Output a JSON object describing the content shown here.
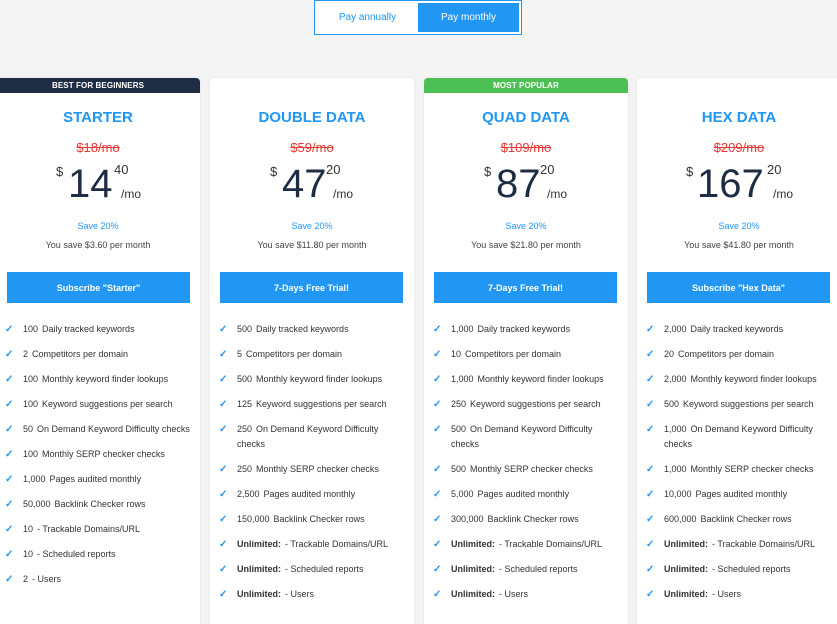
{
  "billing_toggle": {
    "annual": "Pay annually",
    "monthly": "Pay monthly"
  },
  "accent_color": "#2196f3",
  "plans": [
    {
      "ribbon": "BEST FOR BEGINNERS",
      "name": "STARTER",
      "old_price_cur": "$",
      "old_price": "18/mo",
      "currency": "$",
      "price_int": "14",
      "price_cents": "40",
      "per": "/mo",
      "save_pct": "Save 20%",
      "save_amt": "You save $3.60 per month",
      "cta": "Subscribe \"Starter\"",
      "features": [
        {
          "num": "100",
          "text": "Daily tracked keywords"
        },
        {
          "num": "2",
          "text": "Competitors per domain"
        },
        {
          "num": "100",
          "text": "Monthly keyword finder lookups"
        },
        {
          "num": "100",
          "text": "Keyword suggestions per search"
        },
        {
          "num": "50",
          "text": "On Demand Keyword Difficulty checks"
        },
        {
          "num": "100",
          "text": "Monthly SERP checker checks"
        },
        {
          "num": "1,000",
          "text": "Pages audited monthly"
        },
        {
          "num": "50,000",
          "text": "Backlink Checker rows"
        },
        {
          "num": "10",
          "text": "- Trackable Domains/URL"
        },
        {
          "num": "10",
          "text": "- Scheduled reports"
        },
        {
          "num": "2",
          "text": "- Users"
        }
      ]
    },
    {
      "ribbon": "",
      "name": "DOUBLE DATA",
      "old_price_cur": "$",
      "old_price": "59/mo",
      "currency": "$",
      "price_int": "47",
      "price_cents": "20",
      "per": "/mo",
      "save_pct": "Save 20%",
      "save_amt": "You save $11.80 per month",
      "cta": "7-Days Free Trial!",
      "features": [
        {
          "num": "500",
          "text": "Daily tracked keywords"
        },
        {
          "num": "5",
          "text": "Competitors per domain"
        },
        {
          "num": "500",
          "text": "Monthly keyword finder lookups"
        },
        {
          "num": "125",
          "text": "Keyword suggestions per search"
        },
        {
          "num": "250",
          "text": "On Demand Keyword Difficulty checks"
        },
        {
          "num": "250",
          "text": "Monthly SERP checker checks"
        },
        {
          "num": "2,500",
          "text": "Pages audited monthly"
        },
        {
          "num": "150,000",
          "text": "Backlink Checker rows"
        },
        {
          "num": "Unlimited:",
          "text": "- Trackable Domains/URL",
          "bold": true
        },
        {
          "num": "Unlimited:",
          "text": "- Scheduled reports",
          "bold": true
        },
        {
          "num": "Unlimited:",
          "text": "- Users",
          "bold": true
        }
      ]
    },
    {
      "ribbon": "MOST POPULAR",
      "name": "QUAD DATA",
      "old_price_cur": "$",
      "old_price": "109/mo",
      "currency": "$",
      "price_int": "87",
      "price_cents": "20",
      "per": "/mo",
      "save_pct": "Save 20%",
      "save_amt": "You save $21.80 per month",
      "cta": "7-Days Free Trial!",
      "features": [
        {
          "num": "1,000",
          "text": "Daily tracked keywords"
        },
        {
          "num": "10",
          "text": "Competitors per domain"
        },
        {
          "num": "1,000",
          "text": "Monthly keyword finder lookups"
        },
        {
          "num": "250",
          "text": "Keyword suggestions per search"
        },
        {
          "num": "500",
          "text": "On Demand Keyword Difficulty checks"
        },
        {
          "num": "500",
          "text": "Monthly SERP checker checks"
        },
        {
          "num": "5,000",
          "text": "Pages audited monthly"
        },
        {
          "num": "300,000",
          "text": "Backlink Checker rows"
        },
        {
          "num": "Unlimited:",
          "text": "- Trackable Domains/URL",
          "bold": true
        },
        {
          "num": "Unlimited:",
          "text": "- Scheduled reports",
          "bold": true
        },
        {
          "num": "Unlimited:",
          "text": "- Users",
          "bold": true
        }
      ]
    },
    {
      "ribbon": "",
      "name": "HEX DATA",
      "old_price_cur": "$",
      "old_price": "209/mo",
      "currency": "$",
      "price_int": "167",
      "price_cents": "20",
      "per": "/mo",
      "save_pct": "Save 20%",
      "save_amt": "You save $41.80 per month",
      "cta": "Subscribe \"Hex Data\"",
      "features": [
        {
          "num": "2,000",
          "text": "Daily tracked keywords"
        },
        {
          "num": "20",
          "text": "Competitors per domain"
        },
        {
          "num": "2,000",
          "text": "Monthly keyword finder lookups"
        },
        {
          "num": "500",
          "text": "Keyword suggestions per search"
        },
        {
          "num": "1,000",
          "text": "On Demand Keyword Difficulty checks"
        },
        {
          "num": "1,000",
          "text": "Monthly SERP checker checks"
        },
        {
          "num": "10,000",
          "text": "Pages audited monthly"
        },
        {
          "num": "600,000",
          "text": "Backlink Checker rows"
        },
        {
          "num": "Unlimited:",
          "text": "- Trackable Domains/URL",
          "bold": true
        },
        {
          "num": "Unlimited:",
          "text": "- Scheduled reports",
          "bold": true
        },
        {
          "num": "Unlimited:",
          "text": "- Users",
          "bold": true
        }
      ]
    }
  ]
}
